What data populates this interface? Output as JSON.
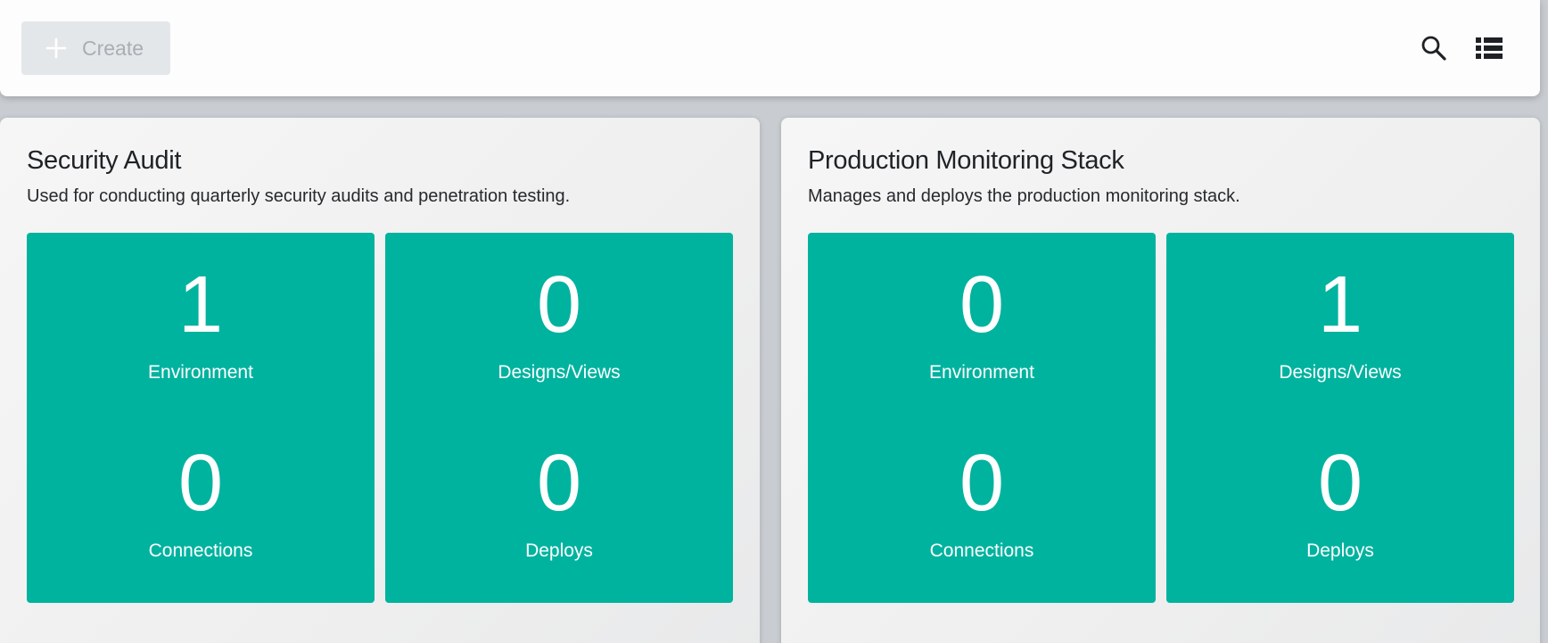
{
  "toolbar": {
    "create_label": "Create",
    "create_icon": "plus-icon",
    "search_icon": "search-icon",
    "view_icon": "list-view-icon"
  },
  "colors": {
    "tile_bg": "#00b39f",
    "tile_text": "#ffffff",
    "create_button_bg": "#e4e7ea",
    "create_button_text": "#a8aeb3"
  },
  "workspaces": [
    {
      "title": "Security Audit",
      "description": "Used for conducting quarterly security audits and penetration testing.",
      "stats": {
        "environments": {
          "value": "1",
          "label": "Environment"
        },
        "designs": {
          "value": "0",
          "label": "Designs/Views"
        },
        "connections": {
          "value": "0",
          "label": "Connections"
        },
        "deploys": {
          "value": "0",
          "label": "Deploys"
        }
      }
    },
    {
      "title": "Production Monitoring Stack",
      "description": "Manages and deploys the production monitoring stack.",
      "stats": {
        "environments": {
          "value": "0",
          "label": "Environment"
        },
        "designs": {
          "value": "1",
          "label": "Designs/Views"
        },
        "connections": {
          "value": "0",
          "label": "Connections"
        },
        "deploys": {
          "value": "0",
          "label": "Deploys"
        }
      }
    }
  ]
}
